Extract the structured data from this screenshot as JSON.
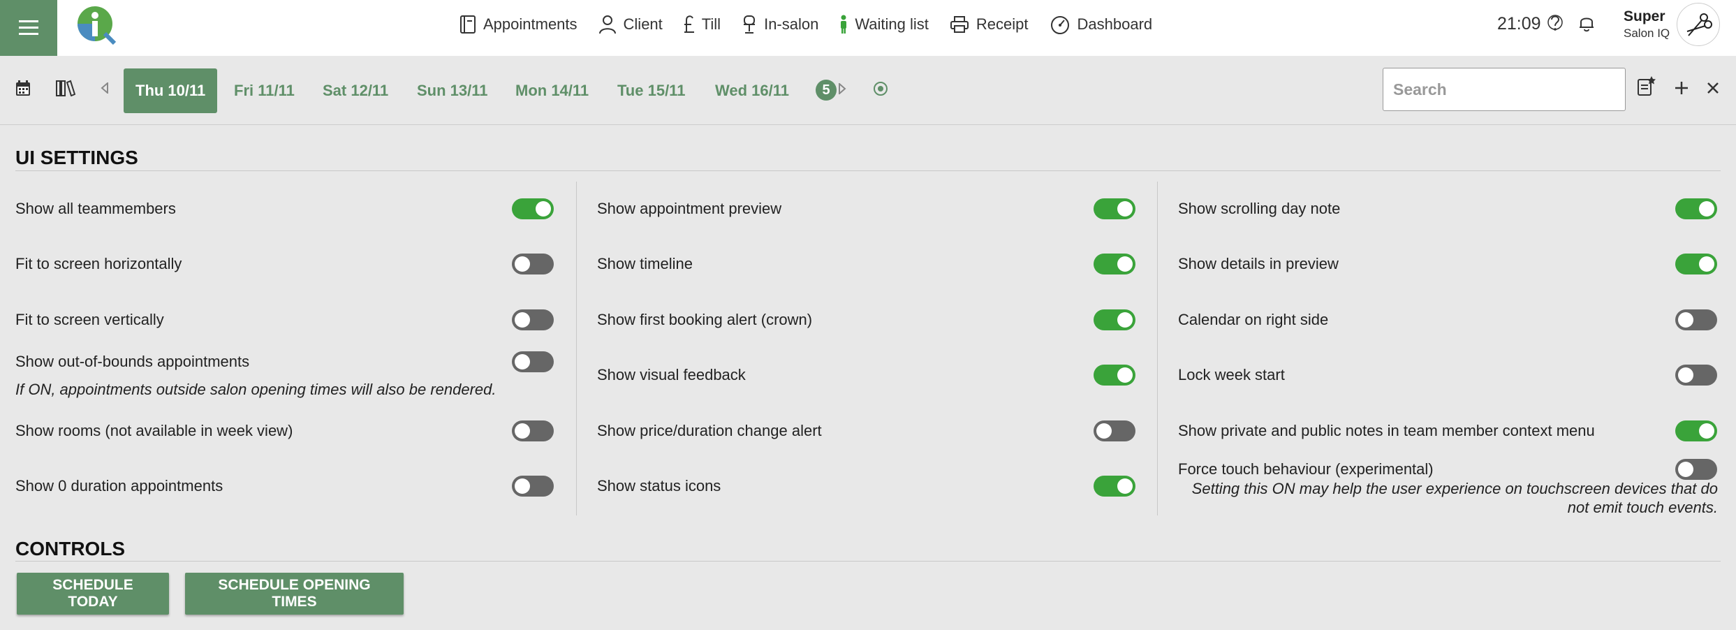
{
  "brand": {
    "logo_letter": "i",
    "accent": "#5f8f68",
    "toggle_on": "#3aa33a",
    "toggle_off": "#666666"
  },
  "nav": {
    "items": [
      {
        "label": "Appointments",
        "icon": "book-icon"
      },
      {
        "label": "Client",
        "icon": "person-icon"
      },
      {
        "label": "Till",
        "icon": "pound-icon"
      },
      {
        "label": "In-salon",
        "icon": "salon-chair-icon"
      },
      {
        "label": "Waiting list",
        "icon": "standing-person-icon"
      },
      {
        "label": "Receipt",
        "icon": "printer-icon"
      },
      {
        "label": "Dashboard",
        "icon": "gauge-icon"
      }
    ]
  },
  "header": {
    "time": "21:09",
    "user_name": "Super",
    "salon_name": "Salon IQ"
  },
  "datebar": {
    "days": [
      "Thu 10/11",
      "Fri 11/11",
      "Sat 12/11",
      "Sun 13/11",
      "Mon 14/11",
      "Tue 15/11",
      "Wed 16/11"
    ],
    "active_index": 0,
    "week_badge": "5",
    "search_placeholder": "Search"
  },
  "ui_settings": {
    "title": "UI SETTINGS",
    "col1": [
      {
        "label": "Show all teammembers",
        "on": true
      },
      {
        "label": "Fit to screen horizontally",
        "on": false
      },
      {
        "label": "Fit to screen vertically",
        "on": false
      },
      {
        "label": "Show out-of-bounds appointments",
        "on": false,
        "note": "If ON, appointments outside salon opening times will also be rendered."
      },
      {
        "label": "Show rooms (not available in week view)",
        "on": false
      },
      {
        "label": "Show 0 duration appointments",
        "on": false
      }
    ],
    "col2": [
      {
        "label": "Show appointment preview",
        "on": true
      },
      {
        "label": "Show timeline",
        "on": true
      },
      {
        "label": "Show first booking alert (crown)",
        "on": true
      },
      {
        "label": "Show visual feedback",
        "on": true
      },
      {
        "label": "Show price/duration change alert",
        "on": false
      },
      {
        "label": "Show status icons",
        "on": true
      }
    ],
    "col3": [
      {
        "label": "Show scrolling day note",
        "on": true
      },
      {
        "label": "Show details in preview",
        "on": true
      },
      {
        "label": "Calendar on right side",
        "on": false
      },
      {
        "label": "Lock week start",
        "on": false
      },
      {
        "label": "Show private and public notes in team member context menu",
        "on": true
      },
      {
        "label": "Force touch behaviour (experimental)",
        "on": false,
        "note_line1": "Setting this ON may help the user experience on touchscreen devices that do",
        "note_line2": "not emit touch events."
      }
    ]
  },
  "controls": {
    "title": "CONTROLS",
    "buttons": [
      "SCHEDULE TODAY",
      "SCHEDULE OPENING TIMES"
    ]
  }
}
